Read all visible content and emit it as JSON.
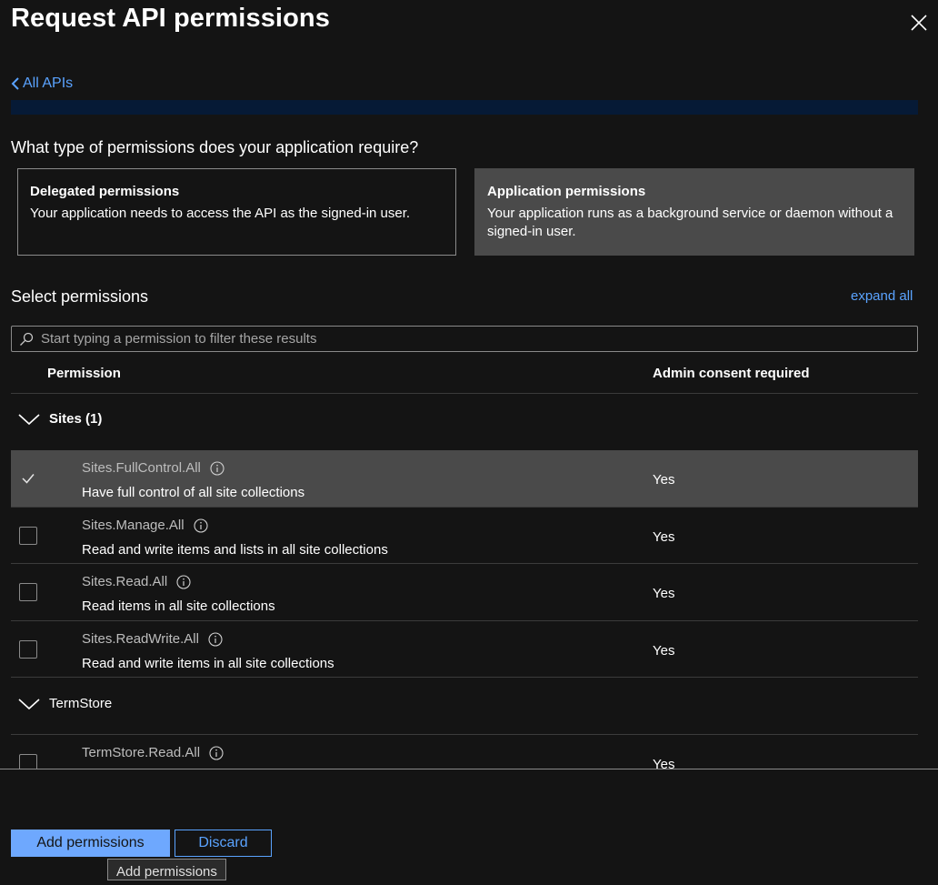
{
  "header": {
    "title": "Request API permissions",
    "back_label": "All APIs"
  },
  "question": "What type of permissions does your application require?",
  "permission_types": {
    "delegated": {
      "title": "Delegated permissions",
      "description": "Your application needs to access the API as the signed-in user."
    },
    "application": {
      "title": "Application permissions",
      "description": "Your application runs as a background service or daemon without a signed-in user.",
      "selected": true
    }
  },
  "select": {
    "heading": "Select permissions",
    "expand_all": "expand all",
    "search_placeholder": "Start typing a permission to filter these results"
  },
  "table": {
    "col_permission": "Permission",
    "col_admin": "Admin consent required",
    "groups": [
      {
        "label": "Sites (1)",
        "rows": [
          {
            "name": "Sites.FullControl.All",
            "desc": "Have full control of all site collections",
            "admin": "Yes",
            "checked": true
          },
          {
            "name": "Sites.Manage.All",
            "desc": "Read and write items and lists in all site collections",
            "admin": "Yes",
            "checked": false
          },
          {
            "name": "Sites.Read.All",
            "desc": "Read items in all site collections",
            "admin": "Yes",
            "checked": false
          },
          {
            "name": "Sites.ReadWrite.All",
            "desc": "Read and write items in all site collections",
            "admin": "Yes",
            "checked": false
          }
        ]
      },
      {
        "label": "TermStore",
        "rows": [
          {
            "name": "TermStore.Read.All",
            "admin": "Yes",
            "checked": false
          }
        ]
      }
    ]
  },
  "footer": {
    "add_label": "Add permissions",
    "discard_label": "Discard",
    "tooltip": "Add permissions"
  },
  "colors": {
    "accent": "#5aa3ff",
    "primary_button": "#6ea8fe",
    "selected_bg": "#4a4a4a",
    "background": "#141414"
  }
}
